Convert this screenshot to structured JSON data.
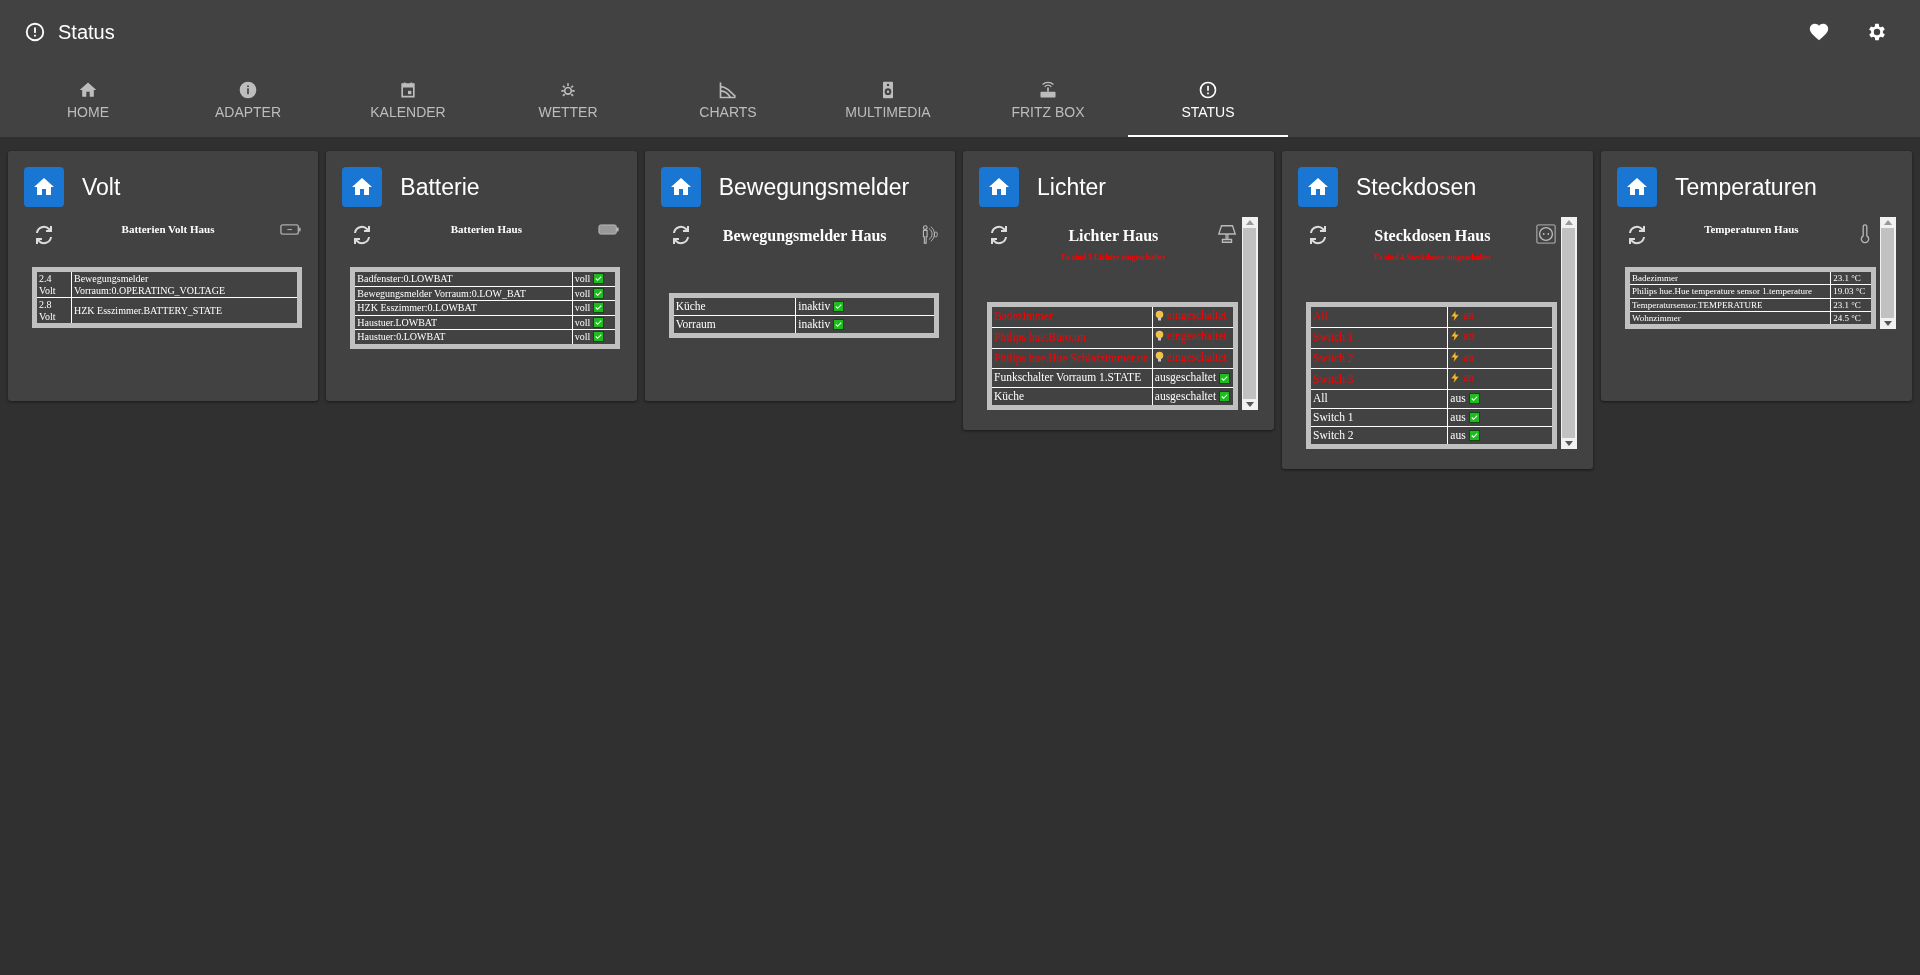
{
  "header": {
    "title": "Status"
  },
  "tabs": [
    {
      "label": "HOME",
      "selected": false
    },
    {
      "label": "ADAPTER",
      "selected": false
    },
    {
      "label": "KALENDER",
      "selected": false
    },
    {
      "label": "WETTER",
      "selected": false
    },
    {
      "label": "CHARTS",
      "selected": false
    },
    {
      "label": "MULTIMEDIA",
      "selected": false
    },
    {
      "label": "FRITZ BOX",
      "selected": false
    },
    {
      "label": "STATUS",
      "selected": true
    }
  ],
  "cards": [
    {
      "title": "Volt",
      "widget_title": "Batterien Volt Haus",
      "scrollable": false,
      "rows": [
        {
          "cells": [
            "2.4 Volt",
            "Bewegungsmelder Vorraum:0.OPERATING_VOLTAGE"
          ],
          "kind": "plain"
        },
        {
          "cells": [
            "2.8 Volt",
            "HZK Esszimmer.BATTERY_STATE"
          ],
          "kind": "plain"
        }
      ]
    },
    {
      "title": "Batterie",
      "widget_title": "Batterien Haus",
      "scrollable": false,
      "rows": [
        {
          "cells": [
            "Badfenster:0.LOWBAT",
            "voll"
          ],
          "kind": "ok"
        },
        {
          "cells": [
            "Bewegungsmelder Vorraum:0.LOW_BAT",
            "voll"
          ],
          "kind": "ok"
        },
        {
          "cells": [
            "HZK Esszimmer:0.LOWBAT",
            "voll"
          ],
          "kind": "ok"
        },
        {
          "cells": [
            "Haustuer.LOWBAT",
            "voll"
          ],
          "kind": "ok"
        },
        {
          "cells": [
            "Haustuer:0.LOWBAT",
            "voll"
          ],
          "kind": "ok"
        }
      ]
    },
    {
      "title": "Bewegungsmelder",
      "widget_title": "Bewegungsmelder Haus",
      "scrollable": false,
      "rows": [
        {
          "cells": [
            "Küche",
            "inaktiv"
          ],
          "kind": "ok"
        },
        {
          "cells": [
            "Vorraum",
            "inaktiv"
          ],
          "kind": "ok"
        }
      ]
    },
    {
      "title": "Lichter",
      "widget_title": "Lichter Haus",
      "subtitle": "Es sind 3 Lichter eingeschaltet",
      "scrollable": true,
      "rows": [
        {
          "cells": [
            "Badezimmer",
            "eingeschaltet"
          ],
          "kind": "bulb"
        },
        {
          "cells": [
            "Philips hue.Büro.on",
            "eingeschaltet"
          ],
          "kind": "bulb"
        },
        {
          "cells": [
            "Philips hue.Hue Schlafzimmer.on",
            "eingeschaltet"
          ],
          "kind": "bulb"
        },
        {
          "cells": [
            "Funkschalter Vorraum 1.STATE",
            "ausgeschaltet"
          ],
          "kind": "ok"
        },
        {
          "cells": [
            "Küche",
            "ausgeschaltet"
          ],
          "kind": "ok"
        }
      ]
    },
    {
      "title": "Steckdosen",
      "widget_title": "Steckdosen Haus",
      "subtitle": "Es sind 4 Steckdosen eingeschaltet",
      "scrollable": true,
      "rows": [
        {
          "cells": [
            "All",
            "an"
          ],
          "kind": "bolt"
        },
        {
          "cells": [
            "Switch 1",
            "an"
          ],
          "kind": "bolt"
        },
        {
          "cells": [
            "Switch 2",
            "an"
          ],
          "kind": "bolt"
        },
        {
          "cells": [
            "Switch 3",
            "an"
          ],
          "kind": "bolt"
        },
        {
          "cells": [
            "All",
            "aus"
          ],
          "kind": "ok"
        },
        {
          "cells": [
            "Switch 1",
            "aus"
          ],
          "kind": "ok"
        },
        {
          "cells": [
            "Switch 2",
            "aus"
          ],
          "kind": "ok"
        }
      ]
    },
    {
      "title": "Temperaturen",
      "widget_title": "Temperaturen Haus",
      "scrollable": true,
      "rows": [
        {
          "cells": [
            "Badezimmer",
            "23.1 °C"
          ],
          "kind": "plain"
        },
        {
          "cells": [
            "Philips hue.Hue temperature sensor 1.temperature",
            "19.03 °C"
          ],
          "kind": "plain"
        },
        {
          "cells": [
            "Temperatursensor.TEMPERATURE",
            "23.1 °C"
          ],
          "kind": "plain"
        },
        {
          "cells": [
            "Wohnzimmer",
            "24.5 °C"
          ],
          "kind": "plain"
        }
      ]
    }
  ]
}
